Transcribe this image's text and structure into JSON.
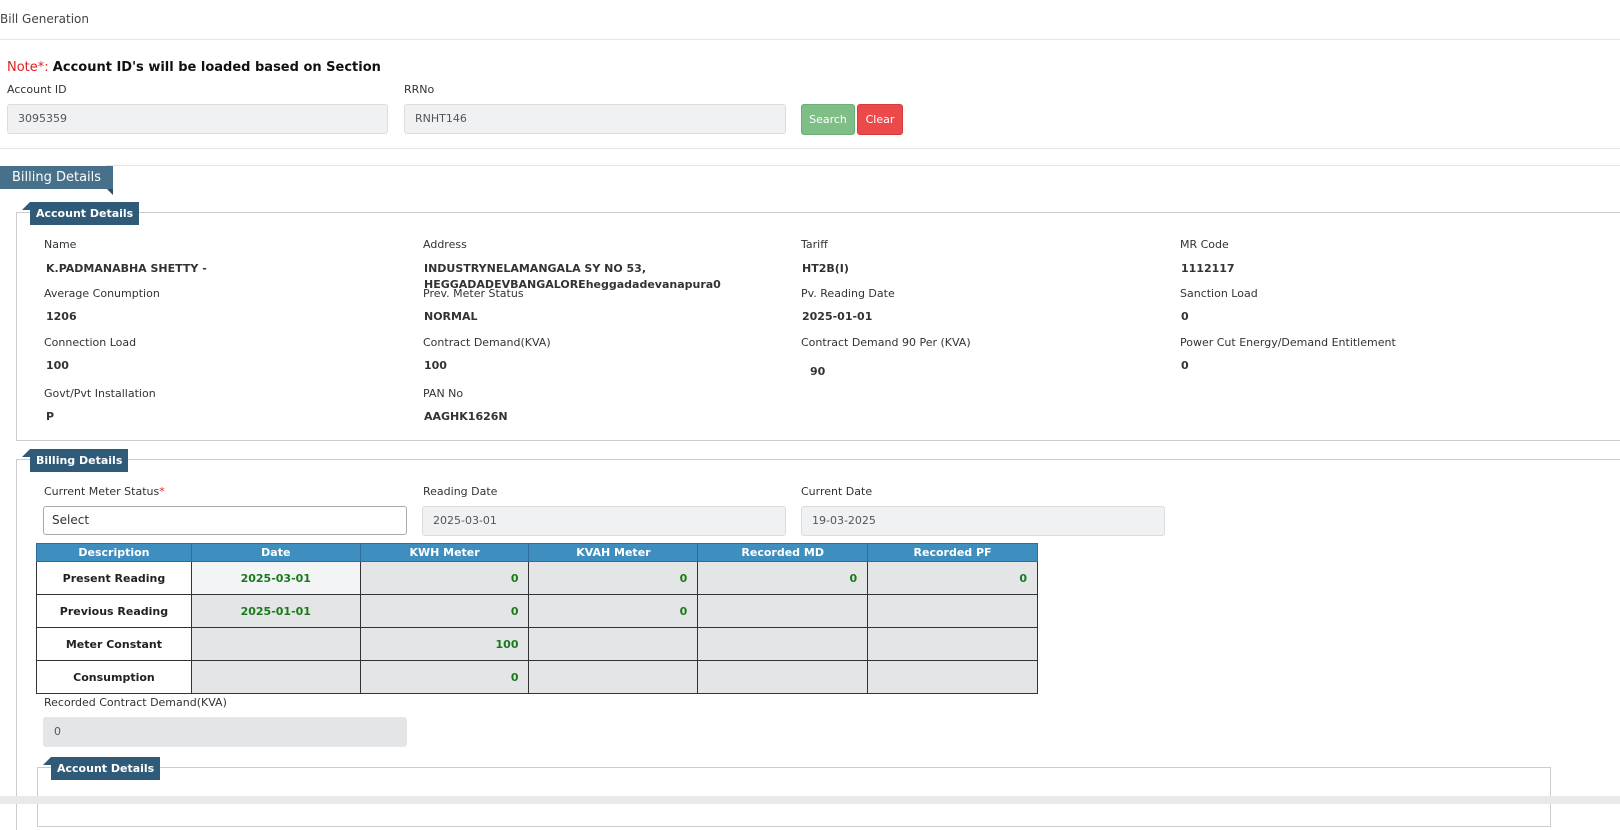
{
  "header": {
    "title": "Bill Generation"
  },
  "note": {
    "prefix": "Note*:",
    "text": "Account ID's will be loaded based on Section"
  },
  "search": {
    "account_id_label": "Account ID",
    "account_id_value": "3095359",
    "rrno_label": "RRNo",
    "rrno_value": "RNHT146",
    "search_label": "Search",
    "clear_label": "Clear"
  },
  "main_tab": "Billing Details",
  "account_details": {
    "legend": "Account Details",
    "fields": [
      {
        "label": "Name",
        "value": "K.PADMANABHA SHETTY -"
      },
      {
        "label": "Address",
        "value": "INDUSTRYNELAMANGALA SY NO 53, HEGGADADEVBANGALOREheggadadevanapura0"
      },
      {
        "label": "Tariff",
        "value": "HT2B(I)"
      },
      {
        "label": "MR Code",
        "value": "1112117"
      },
      {
        "label": "Average Conumption",
        "value": "1206"
      },
      {
        "label": "Prev. Meter Status",
        "value": "NORMAL"
      },
      {
        "label": "Pv. Reading Date",
        "value": "2025-01-01"
      },
      {
        "label": "Sanction Load",
        "value": "0"
      },
      {
        "label": "Connection Load",
        "value": "100"
      },
      {
        "label": "Contract Demand(KVA)",
        "value": "100"
      },
      {
        "label": "Contract Demand 90 Per (KVA)",
        "value": "90"
      },
      {
        "label": "Power Cut Energy/Demand Entitlement",
        "value": "0"
      },
      {
        "label": "Govt/Pvt Installation",
        "value": "P"
      },
      {
        "label": "PAN No",
        "value": "AAGHK1626N"
      }
    ]
  },
  "billing_details": {
    "legend": "Billing Details",
    "meter_status_label": "Current Meter Status",
    "required_mark": "*",
    "meter_status_value": "Select",
    "reading_date_label": "Reading Date",
    "reading_date_value": "2025-03-01",
    "current_date_label": "Current Date",
    "current_date_value": "19-03-2025",
    "table": {
      "headers": [
        "Description",
        "Date",
        "KWH Meter",
        "KVAH Meter",
        "Recorded MD",
        "Recorded PF"
      ],
      "rows": [
        [
          "Present Reading",
          "2025-03-01",
          "0",
          "0",
          "0",
          "0"
        ],
        [
          "Previous Reading",
          "2025-01-01",
          "0",
          "0",
          "",
          ""
        ],
        [
          "Meter Constant",
          "",
          "100",
          "",
          "",
          ""
        ],
        [
          "Consumption",
          "",
          "0",
          "",
          "",
          ""
        ]
      ]
    },
    "recorded_cd_label": "Recorded Contract Demand(KVA)",
    "recorded_cd_value": "0"
  },
  "sub_account_details": {
    "legend": "Account Details"
  },
  "colors": {
    "legend_bg": "#2f5a78",
    "table_header": "#3f8ec0",
    "value_green": "#1a7a1a",
    "clear_red": "#ec4a4a",
    "search_green": "#7fbf87"
  }
}
